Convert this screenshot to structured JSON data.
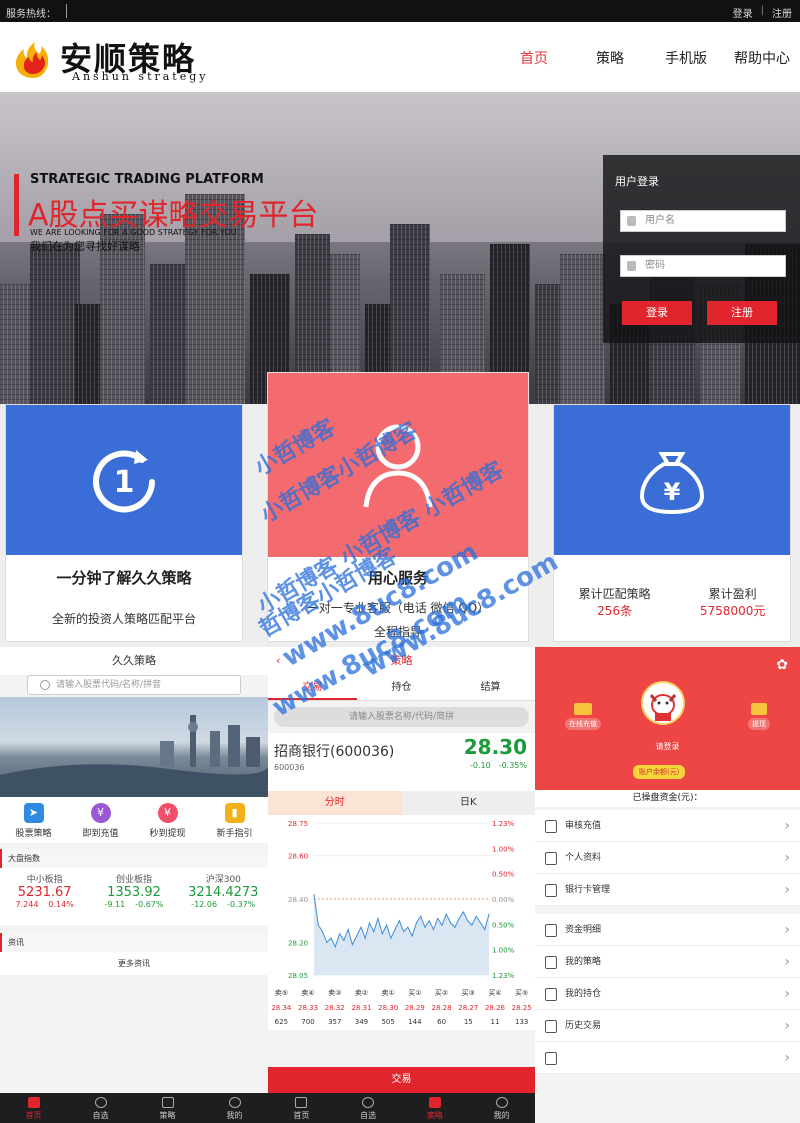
{
  "topbar": {
    "hotline": "服务热线：",
    "login": "登录",
    "register": "注册"
  },
  "brand": {
    "name": "安顺策略",
    "sub": "Anshun strategy"
  },
  "nav": [
    "首页",
    "策略",
    "手机版",
    "帮助中心"
  ],
  "hero": {
    "en": "STRATEGIC TRADING PLATFORM",
    "cn": "A股点买谋略交易平台",
    "en2": "WE ARE LOOKING FOR A GOOD STRATEGY FOR YOU",
    "cn2": "我们在为您寻找好谋略"
  },
  "login_box": {
    "title": "用户登录",
    "username_placeholder": "用户名",
    "password_placeholder": "密码",
    "login": "登录",
    "register": "注册"
  },
  "features": [
    {
      "title": "一分钟了解久久策略",
      "desc": "全新的投资人策略匹配平台",
      "color": "#3a6ed6"
    },
    {
      "title": "用心服务",
      "desc": "一对一专业客服（电话 微信 QQ）",
      "desc2": "全程指导",
      "color": "#f36b6f"
    },
    {
      "stat1_label": "累计匹配策略",
      "stat1_value": "256条",
      "stat2_label": "累计盈利",
      "stat2_value": "5758000元",
      "color": "#3a6ed6"
    }
  ],
  "watermark": [
    "小哲博客",
    "小哲博客小哲博客",
    "小哲博客 小哲博客 小哲博客",
    "哲博客小哲博客",
    "www.8uc8.com",
    "www.8uc8.com",
    "www.8uc8.com"
  ],
  "mobile1": {
    "title": "久久策略",
    "search": "请输入股票代码/名称/拼音",
    "quick": [
      {
        "label": "股票策略",
        "color": "#2f8be0",
        "glyph": "➤"
      },
      {
        "label": "即到充值",
        "color": "#9a58d6",
        "glyph": "¥"
      },
      {
        "label": "秒到提现",
        "color": "#f2506a",
        "glyph": "¥"
      },
      {
        "label": "新手指引",
        "color": "#f2b11a",
        "glyph": "▮"
      }
    ],
    "market_header": "大盘指数",
    "indices": [
      {
        "name": "中小板指",
        "value": "5231.67",
        "chg": "7.244",
        "pct": "0.14%",
        "dir": "up"
      },
      {
        "name": "创业板指",
        "value": "1353.92",
        "chg": "-9.11",
        "pct": "-0.67%",
        "dir": "down"
      },
      {
        "name": "沪深300",
        "value": "3214.4273",
        "chg": "-12.06",
        "pct": "-0.37%",
        "dir": "down"
      }
    ],
    "news_header": "资讯",
    "more_news": "更多资讯",
    "tabbar": [
      "首页",
      "自选",
      "策略",
      "我的"
    ]
  },
  "mobile2": {
    "title": "策略",
    "tabs": [
      "交易",
      "持仓",
      "结算"
    ],
    "search": "请输入股票名称/代码/简拼",
    "stock_name": "招商银行(600036)",
    "stock_code": "600036",
    "price": "28.30",
    "chg": "-0.10",
    "pct": "-0.35%",
    "chart_tabs": [
      "分时",
      "日K"
    ],
    "y_left": [
      "28.75",
      "28.60",
      "28.40",
      "28.20",
      "28.05"
    ],
    "y_right": [
      "1.23%",
      "1.00%",
      "0.50%",
      "0.00%",
      "0.50%",
      "1.00%",
      "1.23%"
    ],
    "chart_data": {
      "type": "line",
      "ylim": [
        28.05,
        28.75
      ],
      "values": [
        28.42,
        28.28,
        28.25,
        28.2,
        28.22,
        28.18,
        28.24,
        28.21,
        28.26,
        28.19,
        28.23,
        28.27,
        28.22,
        28.29,
        28.25,
        28.31,
        28.24,
        28.28,
        28.22,
        28.26,
        28.3,
        28.25,
        28.27,
        28.23,
        28.29,
        28.32,
        28.27,
        28.3,
        28.26,
        28.31,
        28.28,
        28.33,
        28.29,
        28.27,
        28.31,
        28.34,
        28.3,
        28.28,
        28.32,
        28.29,
        28.26,
        28.33
      ]
    },
    "depth": {
      "labels": [
        "卖⑤",
        "卖④",
        "卖③",
        "卖②",
        "卖①",
        "买①",
        "买②",
        "买③",
        "买④",
        "买⑤"
      ],
      "prices": [
        "28.34",
        "28.33",
        "28.32",
        "28.31",
        "28.30",
        "28.29",
        "28.28",
        "28.27",
        "28.26",
        "28.25"
      ],
      "volumes": [
        "625",
        "700",
        "357",
        "349",
        "505",
        "144",
        "60",
        "15",
        "11",
        "133"
      ]
    },
    "trade_button": "交易",
    "tabbar": [
      "首页",
      "自选",
      "策略",
      "我的"
    ]
  },
  "mobile3": {
    "recharge": "在线充值",
    "withdraw": "提现",
    "login_prompt": "请登录",
    "balance_badge": "账户余额(元)",
    "operated": "已操盘资金(元)：",
    "group1": [
      "审核充值",
      "个人资料",
      "银行卡管理"
    ],
    "group2": [
      "资金明细",
      "我的策略",
      "我的持仓",
      "历史交易",
      ""
    ]
  }
}
